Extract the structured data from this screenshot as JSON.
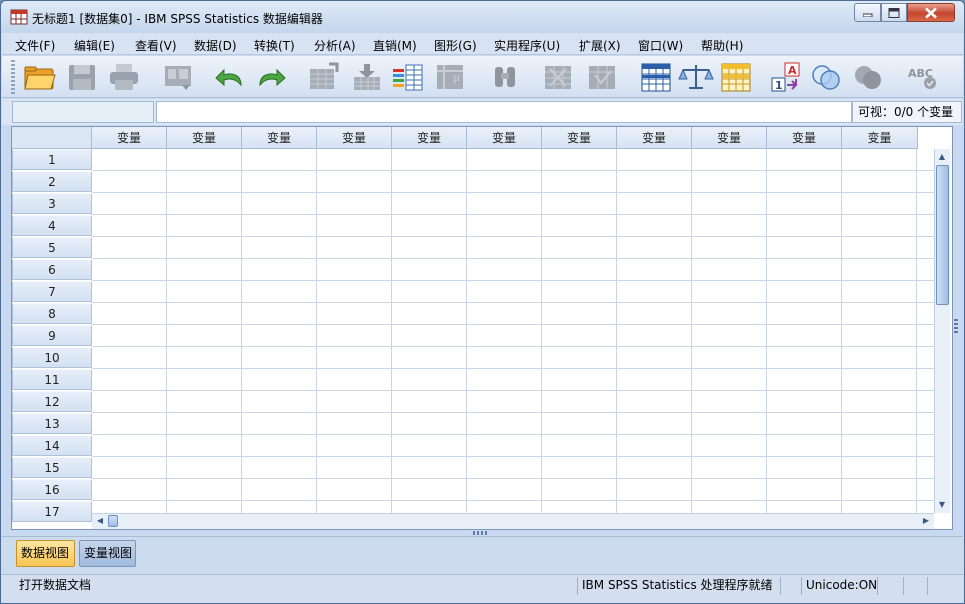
{
  "window": {
    "title": "无标题1 [数据集0] - IBM SPSS Statistics 数据编辑器"
  },
  "menu": {
    "items": [
      {
        "label": "文件(F)"
      },
      {
        "label": "编辑(E)"
      },
      {
        "label": "查看(V)"
      },
      {
        "label": "数据(D)"
      },
      {
        "label": "转换(T)"
      },
      {
        "label": "分析(A)"
      },
      {
        "label": "直销(M)"
      },
      {
        "label": "图形(G)"
      },
      {
        "label": "实用程序(U)"
      },
      {
        "label": "扩展(X)"
      },
      {
        "label": "窗口(W)"
      },
      {
        "label": "帮助(H)"
      }
    ]
  },
  "toolbar": {
    "icons": [
      {
        "name": "open-folder-icon",
        "enabled": true
      },
      {
        "name": "save-icon",
        "enabled": false
      },
      {
        "name": "print-icon",
        "enabled": false
      },
      {
        "name": "recall-dialog-icon",
        "enabled": false
      },
      {
        "name": "undo-icon",
        "enabled": true
      },
      {
        "name": "redo-icon",
        "enabled": true
      },
      {
        "name": "go-to-case-icon",
        "enabled": false
      },
      {
        "name": "go-to-variable-icon",
        "enabled": false
      },
      {
        "name": "variables-icon",
        "enabled": true
      },
      {
        "name": "run-descriptives-icon",
        "enabled": false
      },
      {
        "name": "find-icon",
        "enabled": false
      },
      {
        "name": "insert-cases-icon",
        "enabled": false
      },
      {
        "name": "insert-variable-icon",
        "enabled": false
      },
      {
        "name": "split-file-icon",
        "enabled": true
      },
      {
        "name": "weight-cases-icon",
        "enabled": true
      },
      {
        "name": "select-cases-icon",
        "enabled": true
      },
      {
        "name": "value-labels-icon",
        "enabled": true
      },
      {
        "name": "use-variable-sets-icon",
        "enabled": true
      },
      {
        "name": "show-all-variables-icon",
        "enabled": false
      },
      {
        "name": "spell-check-icon",
        "enabled": false
      }
    ]
  },
  "cell_editor": {
    "reference": "",
    "value": "",
    "visible_label": "可视：0/0 个变量"
  },
  "grid": {
    "column_header": "变量",
    "column_count": 11,
    "rows": [
      "1",
      "2",
      "3",
      "4",
      "5",
      "6",
      "7",
      "8",
      "9",
      "10",
      "11",
      "12",
      "13",
      "14",
      "15",
      "16",
      "17"
    ]
  },
  "tabs": {
    "data_view": "数据视图",
    "variable_view": "变量视图"
  },
  "status": {
    "left": "打开数据文档",
    "processor": "IBM SPSS Statistics 处理程序就绪",
    "unicode": "Unicode:ON"
  }
}
